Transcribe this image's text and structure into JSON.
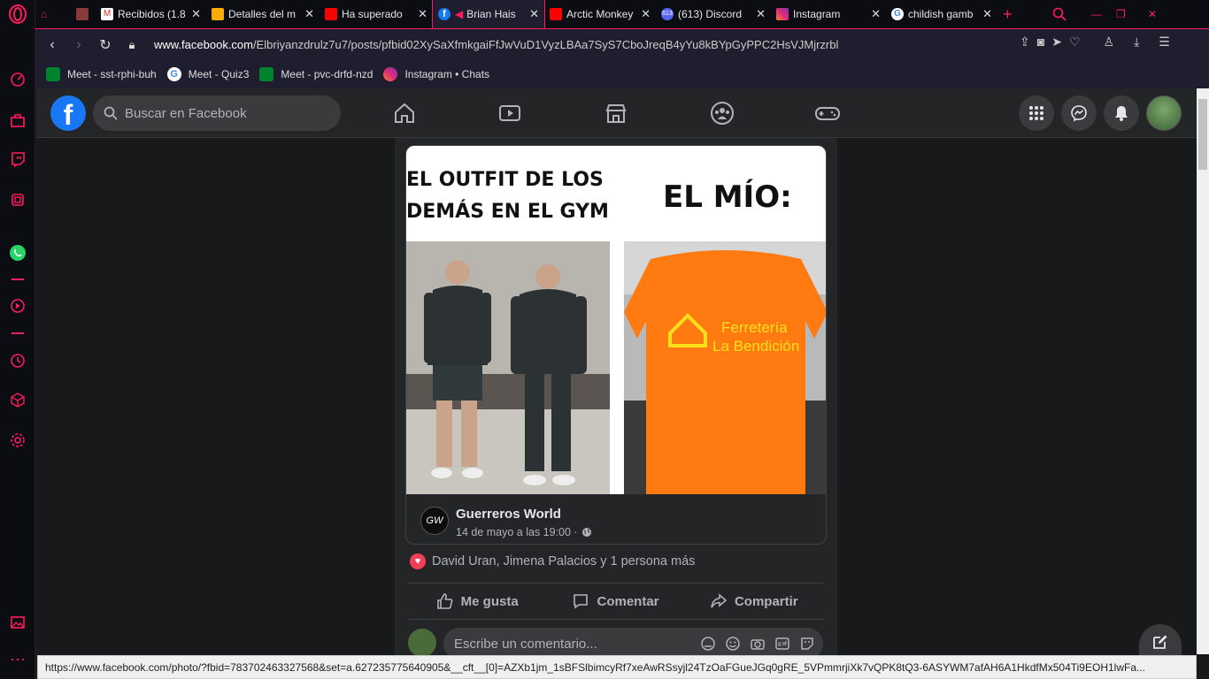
{
  "browser": {
    "tabs": [
      {
        "label": "",
        "icon": "gamepad-icon"
      },
      {
        "label": "",
        "icon": "image-icon"
      },
      {
        "label": "Recibidos (1.8",
        "icon": "gmail-icon"
      },
      {
        "label": "Detalles del m",
        "icon": "classroom-icon"
      },
      {
        "label": "Ha superado",
        "icon": "youtube-icon"
      },
      {
        "label": "Brian Hais",
        "icon": "facebook-icon",
        "active": true
      },
      {
        "label": "Arctic Monkey",
        "icon": "youtube-icon"
      },
      {
        "label": "(613) Discord",
        "icon": "discord-icon"
      },
      {
        "label": "Instagram",
        "icon": "instagram-icon"
      },
      {
        "label": "childish gamb",
        "icon": "google-icon"
      }
    ],
    "discord_badge": "613",
    "url_domain": "www.facebook.com",
    "url_path": "/Elbriyanzdrulz7u7/posts/pfbid02XySaXfmkgaiFfJwVuD1VyzLBAa7SyS7CboJreqB4yYu8kBYpGyPPC2HsVJMjrzrbl",
    "bookmarks": [
      {
        "label": "Meet - sst-rphi-buh",
        "icon": "meet-icon"
      },
      {
        "label": "Meet - Quiz3",
        "icon": "google-icon"
      },
      {
        "label": "Meet - pvc-drfd-nzd",
        "icon": "meet-icon"
      },
      {
        "label": "Instagram • Chats",
        "icon": "instagram-icon"
      }
    ],
    "status_url": "https://www.facebook.com/photo/?fbid=783702463327568&set=a.627235775640905&__cft__[0]=AZXb1jm_1sBFSlbimcyRf7xeAwRSsyjl24TzOaFGueJGq0gRE_5VPmmrjiXk7vQPK8tQ3-6ASYWM7afAH6A1HkdfMx504Ti9EOH1lwFa..."
  },
  "facebook": {
    "logo": "f",
    "search_placeholder": "Buscar en Facebook",
    "meme": {
      "left_caption_1": "EL OUTFIT DE LOS",
      "left_caption_2": "DEMÁS EN EL GYM",
      "right_caption": "EL MÍO:",
      "shirt_text_1": "Ferretería",
      "shirt_text_2": "La Bendición"
    },
    "shared_page": {
      "name": "Guerreros World",
      "avatar_text": "GW",
      "date": "14 de mayo a las 19:00 ·"
    },
    "reactions_text": "David Uran, Jimena Palacios y 1 persona más",
    "actions": {
      "like": "Me gusta",
      "comment": "Comentar",
      "share": "Compartir"
    },
    "comment_placeholder": "Escribe un comentario..."
  },
  "colors": {
    "opera_accent": "#ff1b5e",
    "fb_blue": "#1877f2",
    "fb_surface": "#242526",
    "fb_bg": "#18191a"
  }
}
